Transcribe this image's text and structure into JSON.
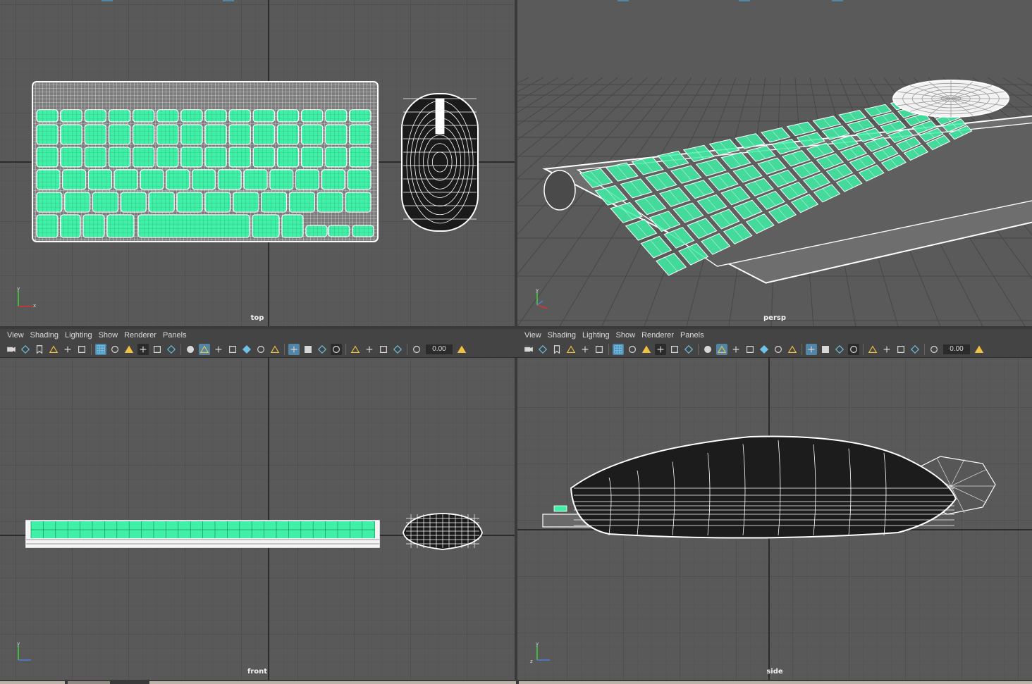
{
  "viewports": {
    "top": {
      "camera": "top"
    },
    "persp": {
      "camera": "persp"
    },
    "front": {
      "camera": "front"
    },
    "side": {
      "camera": "side"
    }
  },
  "panel_menu": [
    "View",
    "Shading",
    "Lighting",
    "Show",
    "Renderer",
    "Panels"
  ],
  "toolbar": {
    "exposure_value": "0.00",
    "icons": [
      "camera-icon",
      "camera-attributes-icon",
      "bookmark-icon",
      "image-plane-icon",
      "pan-zoom-icon",
      "grease-pencil-icon",
      "grid-icon",
      "film-gate-icon",
      "resolution-gate-icon",
      "gate-mask-icon",
      "field-chart-icon",
      "safe-action-icon",
      "wireframe-icon",
      "smooth-shade-icon",
      "wireframe-on-shaded-icon",
      "textured-icon",
      "use-lights-icon",
      "shadows-icon",
      "ambient-occlusion-icon",
      "isolate-select-icon",
      "xray-icon",
      "xray-joints-icon",
      "xray-components-icon",
      "select-camera-icon",
      "two-sided-icon",
      "backface-icon",
      "wireframe-color-icon",
      "exposure-icon",
      "gamma-icon"
    ]
  },
  "axis_labels": {
    "y": "y",
    "x": "x",
    "z": "z"
  }
}
